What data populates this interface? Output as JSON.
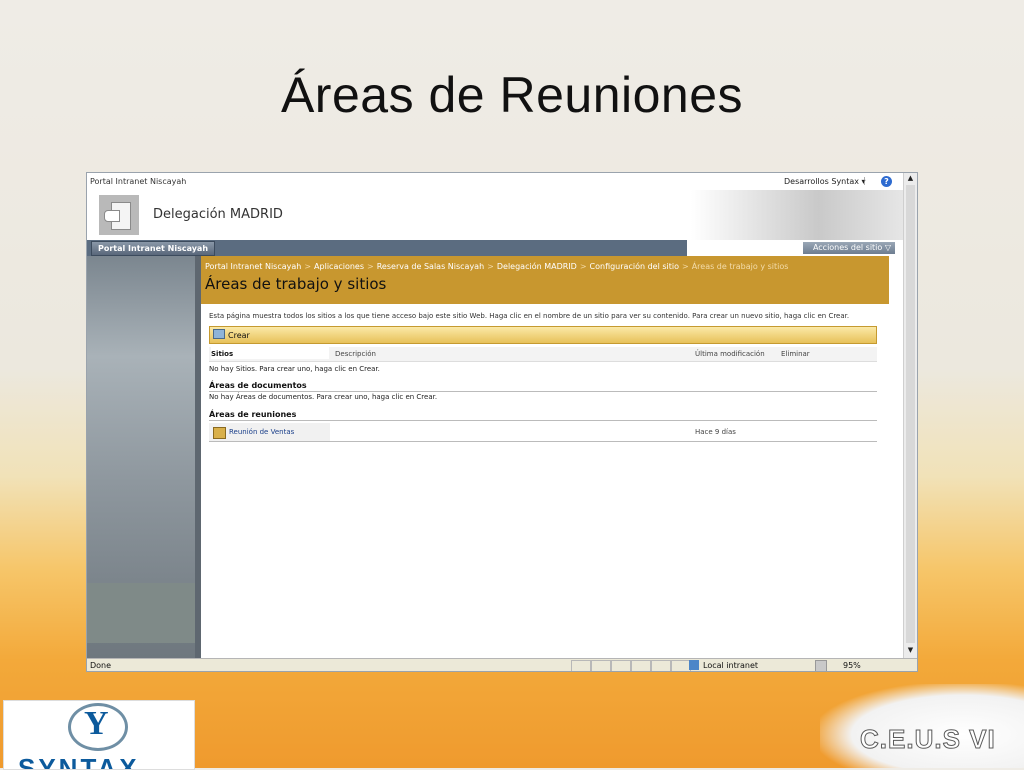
{
  "slide": {
    "title": "Áreas de Reuniones"
  },
  "browser": {
    "top": {
      "site_link": "Portal Intranet Niscayah",
      "user_menu": "Desarrollos Syntax ▾",
      "sep": "|",
      "help_icon": "help-icon"
    },
    "header": {
      "site_title": "Delegación MADRID"
    },
    "nav": {
      "tab": "Portal Intranet Niscayah",
      "site_actions": "Acciones del sitio ▽"
    },
    "breadcrumb": {
      "items": [
        "Portal Intranet Niscayah",
        "Aplicaciones",
        "Reserva de Salas Niscayah",
        "Delegación MADRID",
        "Configuración del sitio"
      ],
      "current": "Áreas de trabajo y sitios",
      "sep": ">"
    },
    "page_title": "Áreas de trabajo y sitios",
    "description": "Esta página muestra todos los sitios a los que tiene acceso bajo este sitio Web. Haga clic en el nombre de un sitio para ver su contenido. Para crear un nuevo sitio, haga clic en Crear.",
    "toolbar": {
      "create_label": "Crear"
    },
    "columns": {
      "sites": "Sitios",
      "description": "Descripción",
      "last_modified": "Última modificación",
      "delete": "Eliminar"
    },
    "no_sites": "No hay Sitios. Para crear uno, haga clic en Crear.",
    "documents_section": {
      "title": "Áreas de documentos",
      "empty": "No hay Áreas de documentos. Para crear uno, haga clic en Crear."
    },
    "meetings_section": {
      "title": "Áreas de reuniones",
      "rows": [
        {
          "name": "Reunión de Ventas",
          "modified": "Hace 9 días"
        }
      ]
    },
    "status": {
      "done": "Done",
      "zone": "Local intranet",
      "zoom": "95%"
    }
  },
  "logos": {
    "syntax_letter": "Y",
    "syntax_word": "SYNTAX",
    "ceus": "C.E.U.S VI"
  }
}
